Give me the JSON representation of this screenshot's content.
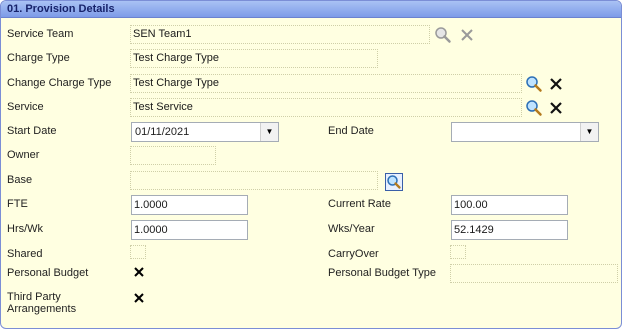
{
  "panel": {
    "title": "01. Provision Details"
  },
  "fields": {
    "service_team": {
      "label": "Service Team",
      "value": "SEN Team1"
    },
    "charge_type": {
      "label": "Charge Type",
      "value": "Test Charge Type"
    },
    "change_charge_type": {
      "label": "Change Charge Type",
      "value": "Test Charge Type"
    },
    "service": {
      "label": "Service",
      "value": "Test Service"
    },
    "start_date": {
      "label": "Start Date",
      "value": "01/11/2021"
    },
    "end_date": {
      "label": "End Date",
      "value": ""
    },
    "owner": {
      "label": "Owner",
      "value": ""
    },
    "base": {
      "label": "Base",
      "value": ""
    },
    "fte": {
      "label": "FTE",
      "value": "1.0000"
    },
    "current_rate": {
      "label": "Current Rate",
      "value": "100.00"
    },
    "hrs_wk": {
      "label": "Hrs/Wk",
      "value": "1.0000"
    },
    "wks_year": {
      "label": "Wks/Year",
      "value": "52.1429"
    },
    "shared": {
      "label": "Shared",
      "checked": false
    },
    "carryover": {
      "label": "CarryOver",
      "checked": false
    },
    "personal_budget": {
      "label": "Personal Budget",
      "checked": true
    },
    "personal_budget_type": {
      "label": "Personal Budget Type",
      "value": ""
    },
    "third_party": {
      "label": "Third Party Arrangements",
      "checked": true
    }
  },
  "icons": {
    "search": "magnifier-icon",
    "clear": "clear-x-icon",
    "dropdown": "chevron-down-icon",
    "check": "x-mark-icon"
  },
  "colors": {
    "panel_bg": "#ffffe1",
    "header_bg": "#7d9be8",
    "header_text": "#17236b"
  }
}
